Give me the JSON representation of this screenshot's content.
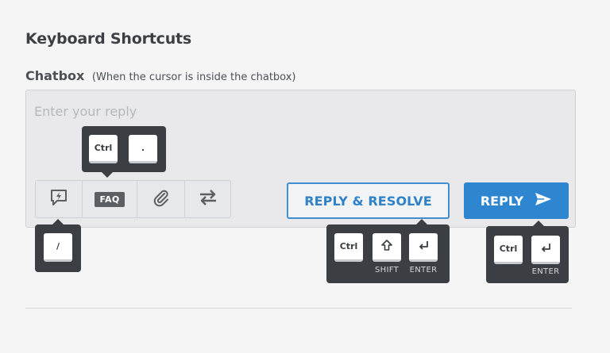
{
  "header": {
    "title": "Keyboard Shortcuts",
    "section_label": "Chatbox",
    "section_note": "(When the cursor is inside the chatbox)"
  },
  "chatbox": {
    "placeholder": "Enter your reply"
  },
  "toolbar": {
    "items": [
      {
        "name": "canned-response",
        "icon": "lightning-bubble-icon"
      },
      {
        "name": "faq",
        "label": "FAQ"
      },
      {
        "name": "attachment",
        "icon": "paperclip-icon"
      },
      {
        "name": "transfer",
        "icon": "swap-arrows-icon"
      }
    ]
  },
  "buttons": {
    "reply_resolve": "REPLY & RESOLVE",
    "reply": "REPLY"
  },
  "shortcuts": {
    "faq": {
      "keys": [
        "Ctrl",
        "."
      ]
    },
    "canned": {
      "keys": [
        "/"
      ]
    },
    "reply_resolve": {
      "keys": [
        "Ctrl",
        "SHIFT",
        "ENTER"
      ],
      "labels": [
        "SHIFT",
        "ENTER"
      ]
    },
    "reply": {
      "keys": [
        "Ctrl",
        "ENTER"
      ],
      "labels": [
        "ENTER"
      ]
    }
  },
  "colors": {
    "accent": "#2f86d0",
    "tooltip_bg": "#3b3f44",
    "background": "#f5f5f6"
  }
}
